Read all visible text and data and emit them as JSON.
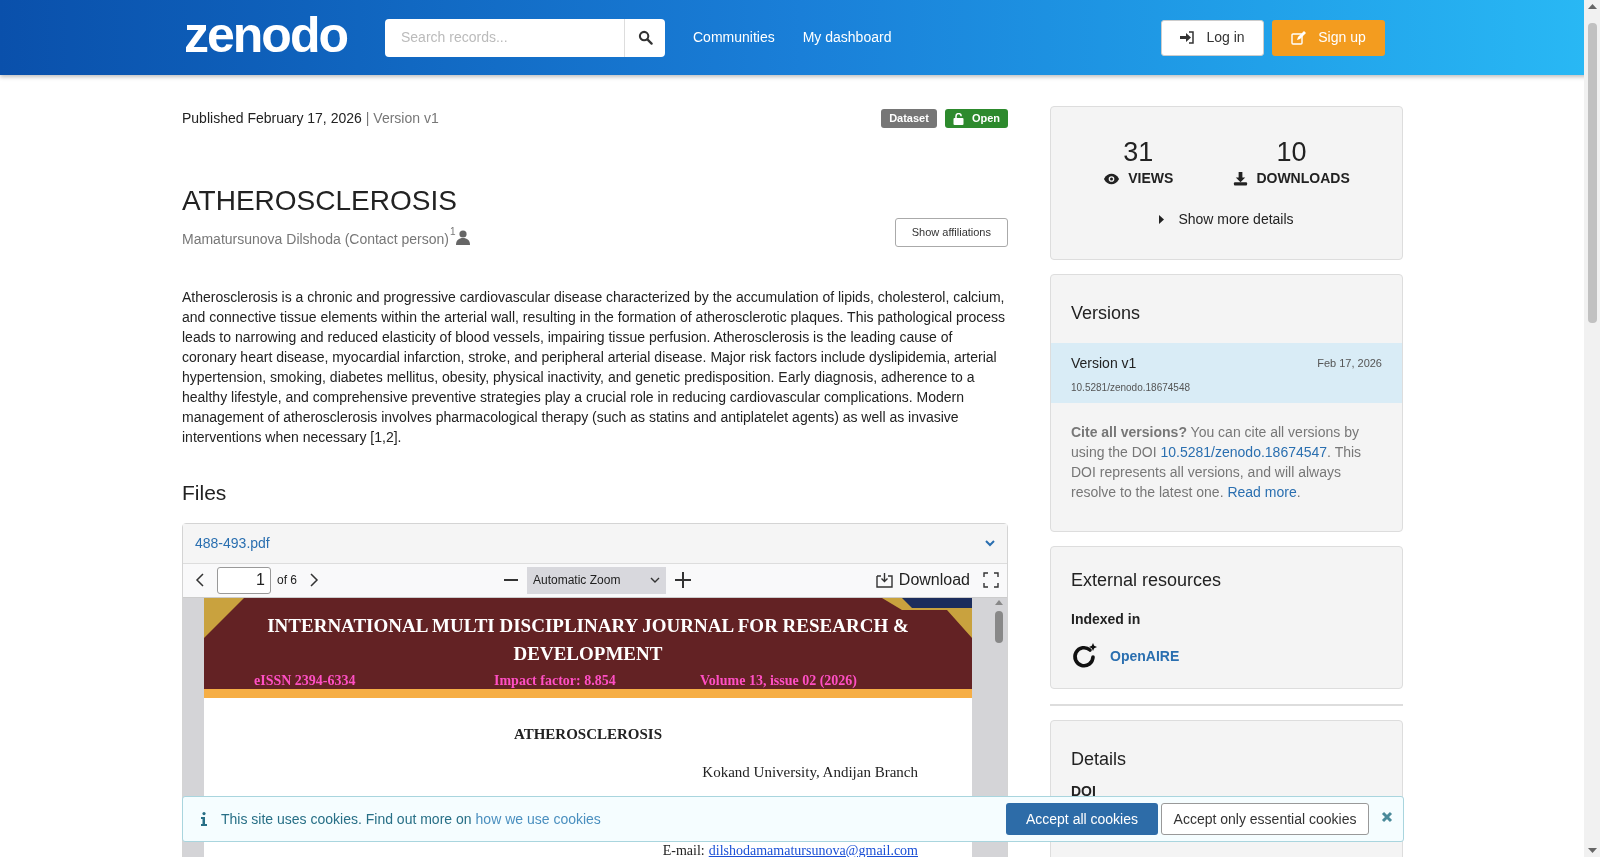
{
  "header": {
    "logo": "zenodo",
    "search_placeholder": "Search records...",
    "nav": [
      "Communities",
      "My dashboard"
    ],
    "login": "Log in",
    "signup": "Sign up"
  },
  "record": {
    "published": "Published February 17, 2026",
    "version": "| Version v1",
    "badges": [
      {
        "label": "Dataset",
        "kind": "type"
      },
      {
        "label": "Open",
        "kind": "access"
      }
    ],
    "title": "ATHEROSCLEROSIS",
    "creator": "Mamatursunova Dilshoda (Contact person)",
    "creator_sup": "1",
    "show_affiliations": "Show affiliations",
    "description": "Atherosclerosis is a chronic and progressive cardiovascular disease characterized by the accumulation of lipids, cholesterol, calcium, and connective tissue elements within the arterial wall, resulting in the formation of atherosclerotic plaques. This pathological process leads to narrowing and reduced elasticity of blood vessels, impairing tissue perfusion. Atherosclerosis is the leading cause of coronary heart disease, myocardial infarction, stroke, and peripheral arterial disease. Major risk factors include dyslipidemia, arterial hypertension, smoking, diabetes mellitus, obesity, physical inactivity, and genetic predisposition. Early diagnosis, adherence to a healthy lifestyle, and comprehensive preventive strategies play a crucial role in reducing cardiovascular complications. Modern management of atherosclerosis involves pharmacological therapy (such as statins and antiplatelet agents) as well as invasive interventions when necessary [1,2]."
  },
  "files": {
    "heading": "Files",
    "file_name": "488-493.pdf",
    "viewer": {
      "page": "1",
      "page_count": "of 6",
      "zoom": "Automatic Zoom",
      "download": "Download"
    },
    "pdf_page": {
      "journal_title": "INTERNATIONAL MULTI DISCIPLINARY JOURNAL FOR RESEARCH & DEVELOPMENT",
      "eissn": "eISSN 2394-6334",
      "impact": "Impact factor: 8.854",
      "volume": "Volume 13, issue 02 (2026)",
      "article_title": "ATHEROSCLEROSIS",
      "affiliation": "Kokand University, Andijan Branch",
      "email_label": "E-mail:",
      "email": "dilshodamamatursunova@gmail.com"
    }
  },
  "sidebar": {
    "stats": [
      {
        "value": "31",
        "label": "VIEWS",
        "kind": "views"
      },
      {
        "value": "10",
        "label": "DOWNLOADS",
        "kind": "downloads"
      }
    ],
    "show_more": "Show more details",
    "versions": {
      "title": "Versions",
      "items": [
        {
          "name": "Version v1",
          "date": "Feb 17, 2026",
          "doi": "10.5281/zenodo.18674548",
          "selected": true
        }
      ],
      "cite_parts": [
        {
          "kind": "text",
          "text": "**Cite all versions?** You can cite all versions by using the DOI "
        },
        {
          "kind": "link",
          "text": "10.5281/zenodo.18674547"
        },
        {
          "kind": "text",
          "text": ". This DOI represents all versions, and will always resolve to the latest one. "
        },
        {
          "kind": "link",
          "text": "Read more"
        },
        {
          "kind": "text",
          "text": "."
        }
      ]
    },
    "external": {
      "title": "External resources",
      "indexed_label": "Indexed in",
      "items": [
        "OpenAIRE"
      ]
    },
    "details": {
      "title": "Details",
      "fields": [
        "DOI"
      ]
    }
  },
  "cookie_banner": {
    "text": "This site uses cookies. Find out more on",
    "link": "how we use cookies",
    "accept_all": "Accept all cookies",
    "accept_essential": "Accept only essential cookies"
  }
}
